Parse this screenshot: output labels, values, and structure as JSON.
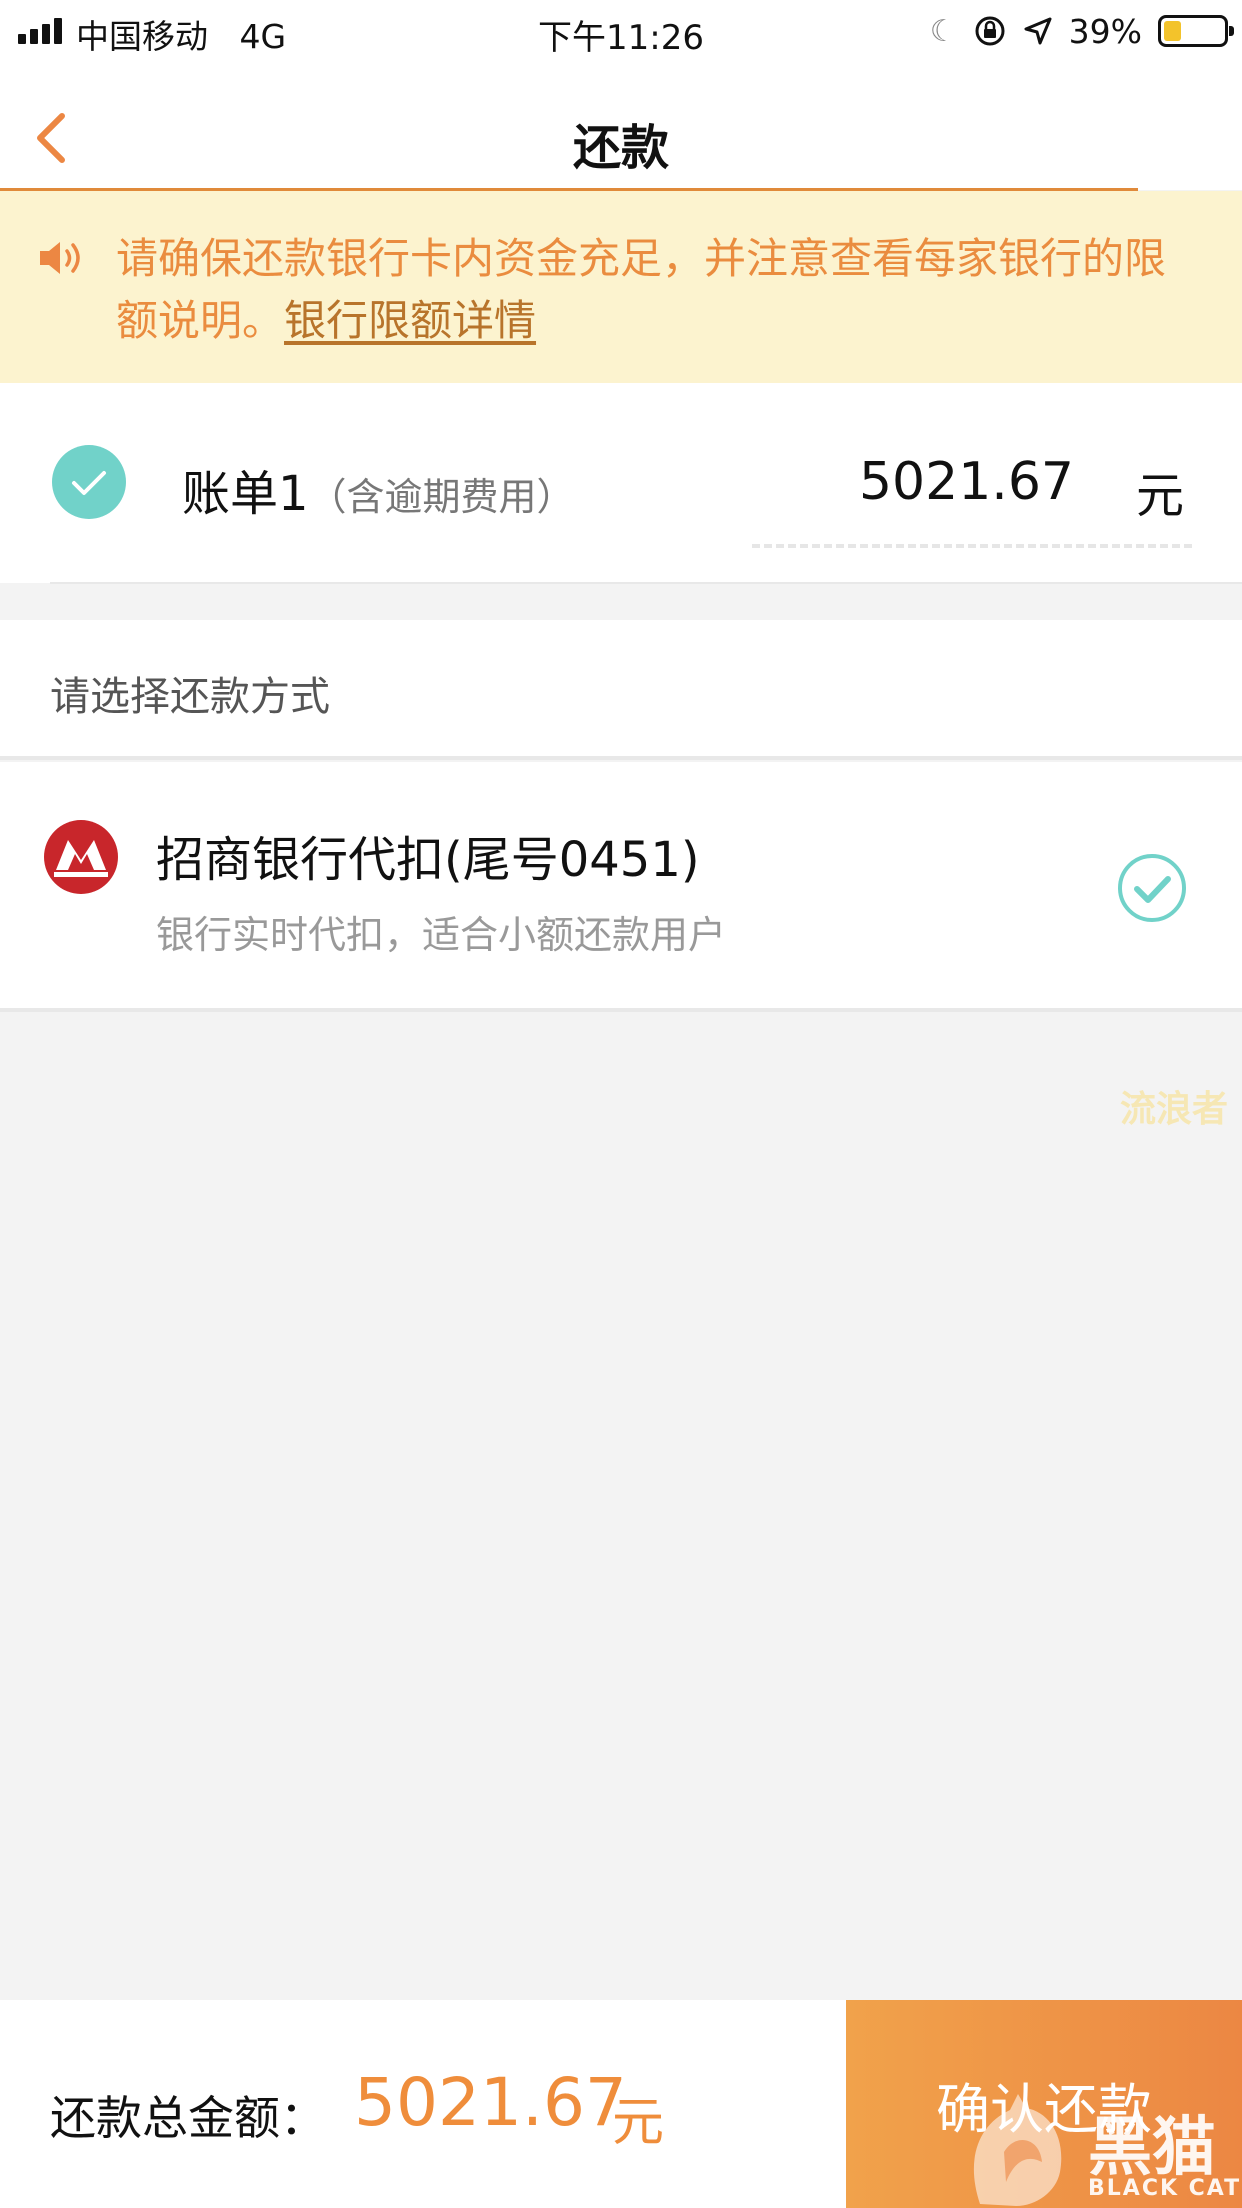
{
  "status_bar": {
    "carrier": "中国移动",
    "network": "4G",
    "time": "下午11:26",
    "battery_percent": "39%",
    "battery_level": 0.3
  },
  "nav": {
    "title": "还款",
    "back_icon": "chevron-left-icon"
  },
  "notice": {
    "icon": "speaker-icon",
    "text": "请确保还款银行卡内资金充足，并注意查看每家银行的限额说明。",
    "link": "银行限额详情"
  },
  "bill": {
    "label": "账单1",
    "note": "（含逾期费用）",
    "amount": "5021.67",
    "unit": "元",
    "checked": true
  },
  "payment": {
    "section_title": "请选择还款方式",
    "method": {
      "title": "招商银行代扣(尾号0451)",
      "subtitle": "银行实时代扣，适合小额还款用户",
      "selected": true
    }
  },
  "watermark": {
    "text": "流浪者",
    "brand": "黑猫",
    "brand_sub": "BLACK CAT"
  },
  "footer": {
    "total_label": "还款总金额：",
    "total_amount": "5021.67",
    "total_unit": "元",
    "confirm_label": "确认还款"
  },
  "colors": {
    "accent": "#ef8d3b",
    "notice_bg": "#fcf3cf",
    "check": "#71d2c9"
  }
}
